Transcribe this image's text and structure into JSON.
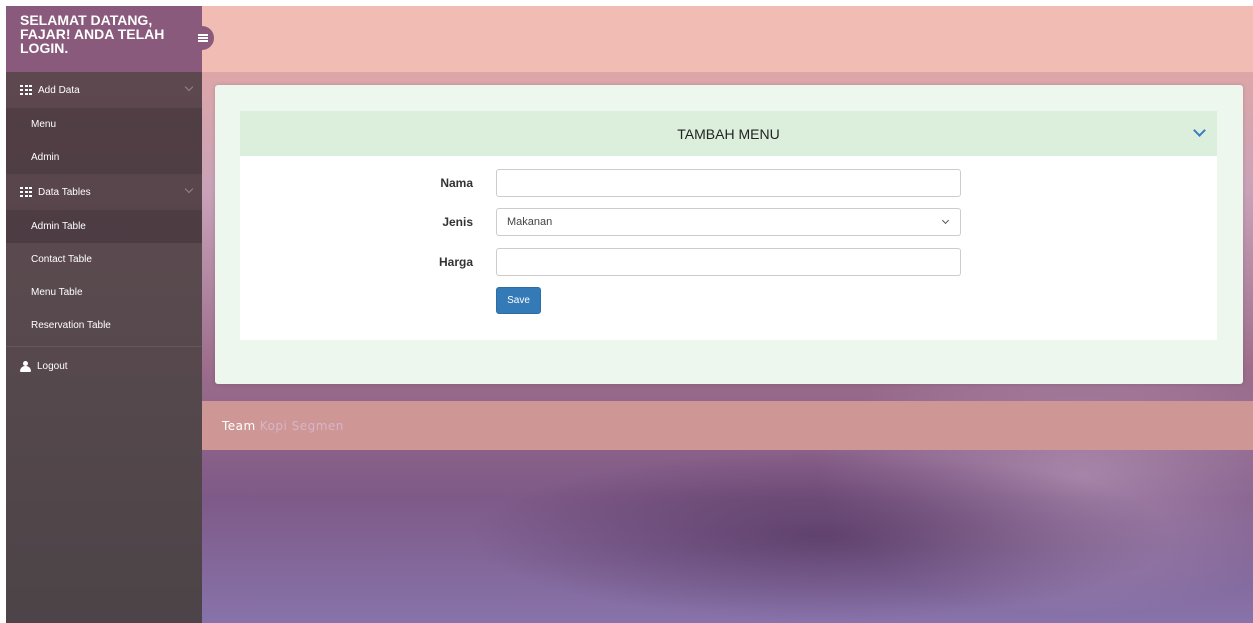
{
  "sidebar": {
    "welcome": "SELAMAT DATANG, FAJAR! ANDA TELAH LOGIN.",
    "groups": [
      {
        "label": "Add Data",
        "icon": "grid-icon",
        "items": [
          {
            "label": "Menu"
          },
          {
            "label": "Admin"
          }
        ]
      },
      {
        "label": "Data Tables",
        "icon": "grid-icon",
        "items": [
          {
            "label": "Admin Table"
          },
          {
            "label": "Contact Table"
          },
          {
            "label": "Menu Table"
          },
          {
            "label": "Reservation Table"
          }
        ]
      }
    ],
    "logout_label": "Logout"
  },
  "panel": {
    "title": "TAMBAH MENU",
    "fields": {
      "nama": {
        "label": "Nama",
        "value": "",
        "placeholder": ""
      },
      "jenis": {
        "label": "Jenis",
        "selected": "Makanan"
      },
      "harga": {
        "label": "Harga",
        "value": "",
        "placeholder": ""
      }
    },
    "save_label": "Save"
  },
  "footer": {
    "team": "Team",
    "brand": "Kopi Segmen"
  },
  "colors": {
    "sidebar_header": "#8a5a7c",
    "topbar": "#f0bcb4",
    "primary_button": "#337ab7",
    "panel_header": "#dcefdc",
    "footer": "#cf9696"
  }
}
